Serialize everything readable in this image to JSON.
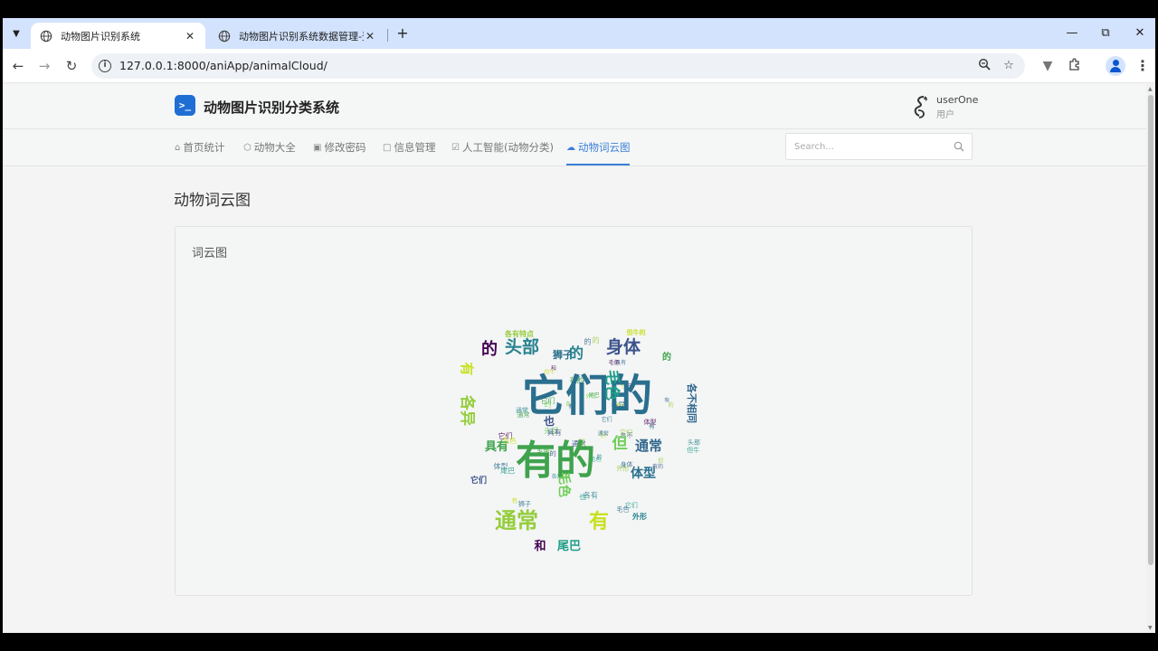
{
  "browser": {
    "tabs": [
      {
        "title": "动物图片识别系统",
        "active": true
      },
      {
        "title": "动物图片识别系统数据管理-登录",
        "active": false
      }
    ],
    "url": "127.0.0.1:8000/aniApp/animalCloud/"
  },
  "site": {
    "logo_glyph": ">_",
    "name": "动物图片识别分类系统",
    "user": {
      "name": "userOne",
      "role": "用户"
    }
  },
  "nav": {
    "items": [
      {
        "icon": "home-icon",
        "label": "首页统计"
      },
      {
        "icon": "cube-icon",
        "label": "动物大全"
      },
      {
        "icon": "lock-icon",
        "label": "修改密码"
      },
      {
        "icon": "file-icon",
        "label": "信息管理"
      },
      {
        "icon": "checkbox-icon",
        "label": "人工智能(动物分类)"
      },
      {
        "icon": "cloud-icon",
        "label": "动物词云图",
        "active": true
      }
    ],
    "search_placeholder": "Search..."
  },
  "main": {
    "page_title": "动物词云图",
    "card_title": "词云图",
    "wordcloud": {
      "words": [
        "它们的",
        "有的",
        "通常",
        "有",
        "头部",
        "身体",
        "的",
        "毛色",
        "但",
        "通常",
        "体型",
        "具有",
        "各异",
        "有",
        "的",
        "也",
        "和",
        "尾巴",
        "毛色",
        "各不相同",
        "狮子",
        "的",
        "各有特点",
        "但牛的",
        "外形",
        "它们"
      ],
      "colors": [
        "#2a6f8e",
        "#3fa34d",
        "#95cd3c",
        "#c8e020",
        "#26828e",
        "#3b528b",
        "#440154",
        "#1f9e89",
        "#6ece58",
        "#31688e"
      ]
    }
  }
}
